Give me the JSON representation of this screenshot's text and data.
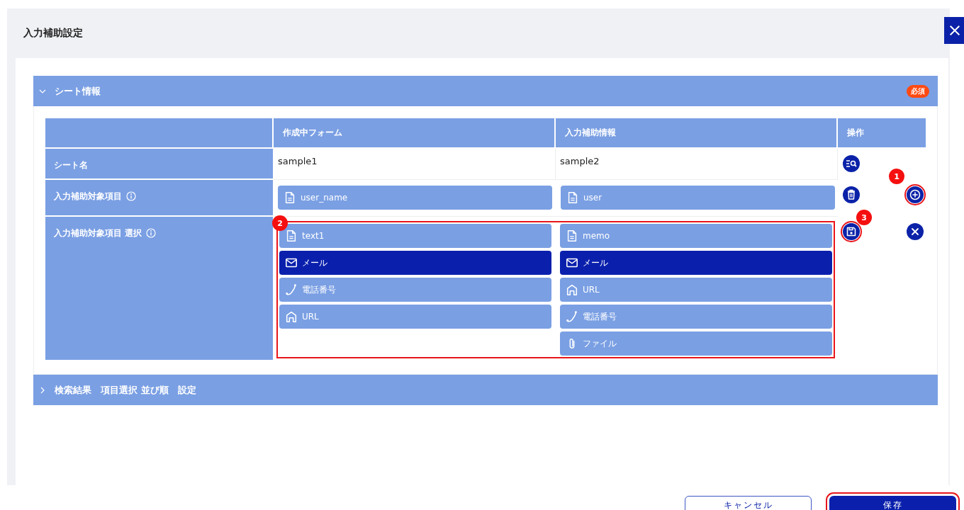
{
  "dialog": {
    "title": "入力補助設定"
  },
  "sections": [
    {
      "title": "シート情報",
      "expanded": true,
      "badge": "必須",
      "table": {
        "columns": [
          "作成中フォーム",
          "入力補助情報",
          "操作"
        ],
        "rows": [
          {
            "kind": "text",
            "label": "シート名",
            "info": false,
            "form": "sample1",
            "assist": "sample2",
            "actions": [
              {
                "kind": "search-list"
              }
            ]
          },
          {
            "kind": "field",
            "label": "入力補助対象項目",
            "info": true,
            "form": [
              {
                "kind": "text",
                "label": "user_name",
                "selected": false
              }
            ],
            "assist": [
              {
                "kind": "text",
                "label": "user",
                "selected": false
              }
            ],
            "actions": [
              {
                "kind": "delete"
              },
              {
                "kind": "add",
                "callout": "1"
              }
            ]
          },
          {
            "kind": "fields",
            "label": "入力補助対象項目 選択",
            "info": true,
            "callout": "2",
            "form": [
              {
                "kind": "text",
                "label": "text1",
                "selected": false
              },
              {
                "kind": "mail",
                "label": "メール",
                "selected": true
              },
              {
                "kind": "phone",
                "label": "電話番号",
                "selected": false
              },
              {
                "kind": "url",
                "label": "URL",
                "selected": false
              }
            ],
            "assist": [
              {
                "kind": "text",
                "label": "memo",
                "selected": false
              },
              {
                "kind": "mail",
                "label": "メール",
                "selected": true
              },
              {
                "kind": "url",
                "label": "URL",
                "selected": false
              },
              {
                "kind": "phone",
                "label": "電話番号",
                "selected": false
              },
              {
                "kind": "file",
                "label": "ファイル",
                "selected": false
              }
            ],
            "actions": [
              {
                "kind": "save",
                "callout": "3"
              },
              {
                "kind": "cancel"
              }
            ]
          }
        ]
      }
    },
    {
      "title": "検索結果　項目選択 並び順　設定",
      "expanded": false
    }
  ],
  "buttons": [
    {
      "label": "キャンセル",
      "kind": "secondary",
      "highlighted": false
    },
    {
      "label": "保存",
      "kind": "primary",
      "highlighted": true
    }
  ]
}
